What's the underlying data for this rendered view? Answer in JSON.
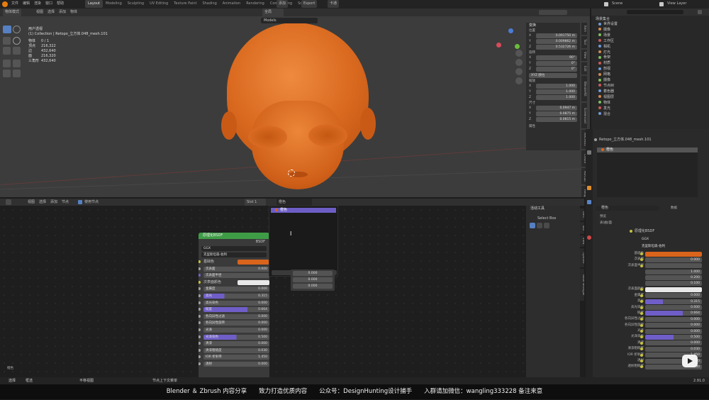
{
  "topbar": {
    "menus": [
      "文件",
      "编辑",
      "渲染",
      "窗口",
      "帮助"
    ],
    "workspaces": [
      "Layout",
      "Modeling",
      "Sculpting",
      "UV Editing",
      "Texture Paint",
      "Shading",
      "Animation",
      "Rendering",
      "Compositing",
      "Scripting"
    ],
    "scene": "Scene",
    "view_layer": "View Layer",
    "add_btn": "添加",
    "export_btn": "Export",
    "sub_btn": "卡通"
  },
  "viewport": {
    "mode": "物体模式",
    "header_items": [
      "视图",
      "选择",
      "添加",
      "物体"
    ],
    "view_name": "用户透视",
    "collection": "(1) Collection | Retopo_立方体.048_mesh.101",
    "stats": [
      {
        "k": "物体",
        "v": "0 / 1"
      },
      {
        "k": "顶点",
        "v": "216,322"
      },
      {
        "k": "边",
        "v": "432,640"
      },
      {
        "k": "面",
        "v": "216,320"
      },
      {
        "k": "三角形",
        "v": "432,640"
      }
    ],
    "transform_orient": "全局",
    "search_label": "Models",
    "n_panel": {
      "title": "变换",
      "loc_label": "位置",
      "loc": [
        {
          "k": "X",
          "v": "0.001750 m"
        },
        {
          "k": "Y",
          "v": "0.009862 m"
        },
        {
          "k": "Z",
          "v": "0.532726 m"
        }
      ],
      "rot_label": "旋转",
      "rot": [
        {
          "k": "X",
          "v": "90°"
        },
        {
          "k": "Y",
          "v": "0°"
        },
        {
          "k": "Z",
          "v": "0°"
        }
      ],
      "rot_mode": "XYZ 欧拉",
      "scale_label": "缩放",
      "scale": [
        {
          "k": "X",
          "v": "1.000"
        },
        {
          "k": "Y",
          "v": "1.000"
        },
        {
          "k": "Z",
          "v": "1.000"
        }
      ],
      "dim_label": "尺寸",
      "dims": [
        {
          "k": "X",
          "v": "0.0947 m"
        },
        {
          "k": "Y",
          "v": "0.0875 m"
        },
        {
          "k": "Z",
          "v": "0.0815 m"
        }
      ],
      "props_label": "属性"
    },
    "side_tabs": [
      "Item",
      "Tool",
      "View",
      "Edit",
      "BlenderKit",
      "Screencast",
      "MACHIN3",
      "Create",
      "Mb-Lab",
      "Retopo",
      "Ground",
      "Sculpt"
    ]
  },
  "outliner": {
    "scene_collection": "场景集合",
    "items": [
      "世界设置",
      "摄像",
      "场景",
      "工作区",
      "相机",
      "灯光",
      "骨架",
      "材质",
      "剖视",
      "网格",
      "摄像",
      "节点树",
      "着色器",
      "视图层",
      "物体",
      "发光",
      "混合"
    ]
  },
  "properties": {
    "object_name": "Retopo_立方体.048_mesh.101",
    "material_slot": "橙色",
    "material_name": "橙色",
    "data_label": "数据",
    "preview_label": "预览",
    "surface_label": "表(曲)面",
    "surface_shader": "原理化BSDF",
    "distribution": "GGX",
    "subsurface_method": "克里斯坦森-伯利",
    "rows": [
      {
        "k": "基础色",
        "v": "",
        "c": "orange"
      },
      {
        "k": "次表面",
        "v": "0.000"
      },
      {
        "k": "次表面半径",
        "v": ""
      },
      {
        "k": "",
        "v": "1.000"
      },
      {
        "k": "",
        "v": "0.200"
      },
      {
        "k": "",
        "v": "0.100"
      },
      {
        "k": "次表面颜色",
        "v": "",
        "c": "white"
      },
      {
        "k": "金属度",
        "v": "0.000"
      },
      {
        "k": "高光",
        "v": "0.315",
        "c": "purple"
      },
      {
        "k": "高光染色",
        "v": "0.000"
      },
      {
        "k": "糙度",
        "v": "0.664",
        "c": "purple"
      },
      {
        "k": "各向异性过滤",
        "v": "0.000"
      },
      {
        "k": "各向异性旋转",
        "v": "0.000"
      },
      {
        "k": "光泽",
        "v": "0.000"
      },
      {
        "k": "光泽染色",
        "v": "0.500",
        "c": "purple"
      },
      {
        "k": "清漆",
        "v": "0.000"
      },
      {
        "k": "清漆粗糙度",
        "v": "0.030"
      },
      {
        "k": "IOR 折射率",
        "v": "1.450"
      },
      {
        "k": "透射",
        "v": "0.000"
      },
      {
        "k": "透射粗糙度",
        "v": "0.000"
      }
    ]
  },
  "node_editor": {
    "header_items": [
      "视图",
      "选择",
      "添加",
      "节点"
    ],
    "use_nodes": "使用节点",
    "slot": "Slot 1",
    "material": "橙色",
    "tool_title": "活动工具",
    "select_box": "Select Box",
    "side_tabs": [
      "Item",
      "Tool",
      "View",
      "Options",
      "Node Wrangler"
    ],
    "node": {
      "title": "原理化BSDF",
      "output": "BSDF",
      "distribution": "GGX",
      "method": "克里斯坦森-伯利",
      "rows": [
        {
          "k": "基础色",
          "v": "",
          "c": "orange",
          "d": "dotg"
        },
        {
          "k": "次表面",
          "v": "0.000",
          "d": ""
        },
        {
          "k": "次表面半径",
          "v": "",
          "d": "dotp"
        },
        {
          "k": "次表面颜色",
          "v": "",
          "c": "white",
          "d": "dotg"
        },
        {
          "k": "金属度",
          "v": "0.000",
          "d": ""
        },
        {
          "k": "高光",
          "v": "0.315",
          "c": "purple",
          "d": ""
        },
        {
          "k": "高光染色",
          "v": "0.000",
          "d": ""
        },
        {
          "k": "糙度",
          "v": "0.664",
          "c": "purple",
          "d": ""
        },
        {
          "k": "各向异性过滤",
          "v": "0.000",
          "d": ""
        },
        {
          "k": "各向异性旋转",
          "v": "0.000",
          "d": ""
        },
        {
          "k": "光泽",
          "v": "0.000",
          "d": ""
        },
        {
          "k": "光泽染色",
          "v": "0.500",
          "c": "purple",
          "d": ""
        },
        {
          "k": "清漆",
          "v": "0.000",
          "d": ""
        },
        {
          "k": "清漆粗糙度",
          "v": "0.030",
          "d": ""
        },
        {
          "k": "IOR 折射率",
          "v": "1.450",
          "d": ""
        },
        {
          "k": "透射",
          "v": "0.000",
          "d": ""
        }
      ]
    },
    "popup_item": "橙色",
    "vec_values": [
      "0.000",
      "0.000",
      "0.000"
    ],
    "bottom_label": "橙色"
  },
  "statusbar": {
    "left": [
      "选择",
      "框选"
    ],
    "mid": "平移视图",
    "right": "节点上下文菜单",
    "version": "2.91.0"
  },
  "watermark": "Blender ＆ Zbrush 内容分享　　致力打造优质内容　　公众号：DesignHunting设计捕手　　入群请加微信：wangling333228 备注来意"
}
